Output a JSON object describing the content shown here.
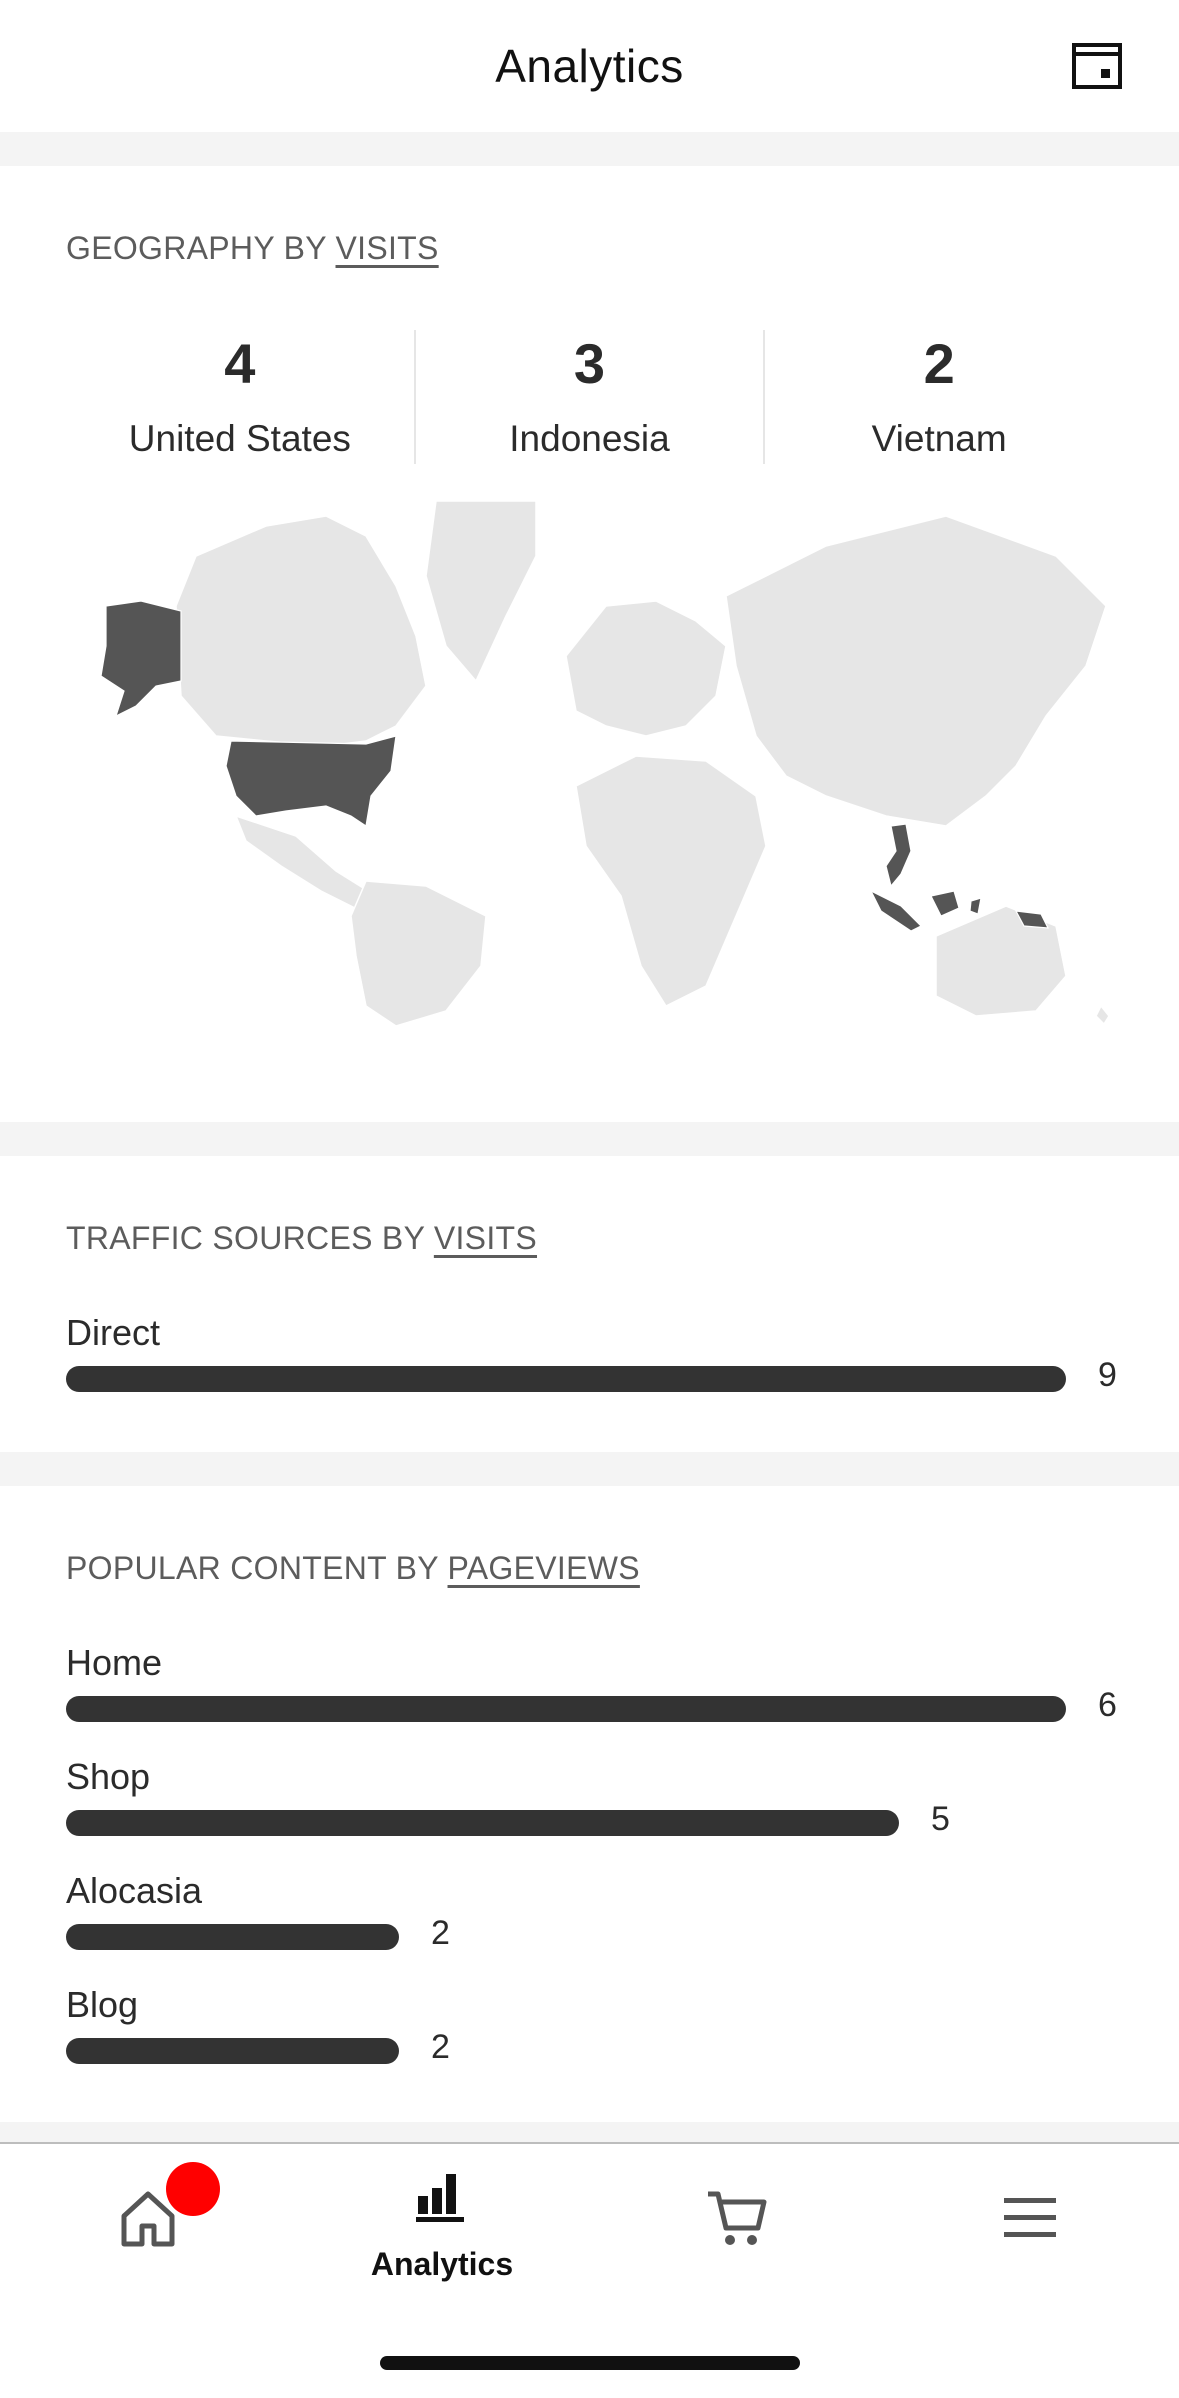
{
  "header": {
    "title": "Analytics",
    "icon": "browser-window-icon"
  },
  "geography": {
    "heading_prefix": "GEOGRAPHY BY",
    "heading_metric": "VISITS",
    "top_countries": [
      {
        "value": "4",
        "country": "United States"
      },
      {
        "value": "3",
        "country": "Indonesia"
      },
      {
        "value": "2",
        "country": "Vietnam"
      }
    ],
    "map": {
      "base_color": "#e6e6e6",
      "highlight_color": "#555555",
      "highlighted": [
        "United States",
        "Indonesia",
        "Vietnam"
      ]
    }
  },
  "traffic": {
    "heading_prefix": "TRAFFIC SOURCES BY",
    "heading_metric": "VISITS",
    "items": [
      {
        "label": "Direct",
        "value": "9",
        "fraction": 1.0
      }
    ]
  },
  "content": {
    "heading_prefix": "POPULAR CONTENT BY",
    "heading_metric": "PAGEVIEWS",
    "items": [
      {
        "label": "Home",
        "value": "6",
        "fraction": 1.0
      },
      {
        "label": "Shop",
        "value": "5",
        "fraction": 0.833
      },
      {
        "label": "Alocasia",
        "value": "2",
        "fraction": 0.333
      },
      {
        "label": "Blog",
        "value": "2",
        "fraction": 0.333
      }
    ]
  },
  "tabbar": {
    "tabs": [
      {
        "icon": "home-icon",
        "label": "",
        "badge": true
      },
      {
        "icon": "analytics-icon",
        "label": "Analytics",
        "selected": true
      },
      {
        "icon": "cart-icon",
        "label": ""
      },
      {
        "icon": "menu-icon",
        "label": ""
      }
    ]
  },
  "colors": {
    "bar": "#333333",
    "background": "#f4f4f4",
    "badge": "#ff0000",
    "heading": "#5c5c5c"
  }
}
